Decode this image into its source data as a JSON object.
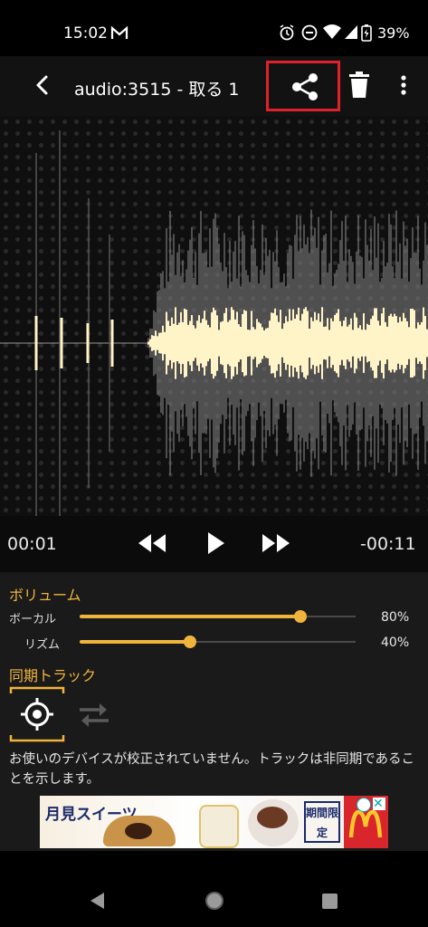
{
  "status": {
    "time": "15:02",
    "battery": "39%"
  },
  "appbar": {
    "title": "audio:3515 - 取る 1"
  },
  "transport": {
    "elapsed": "00:01",
    "remaining": "-00:11"
  },
  "volume": {
    "title": "ボリューム",
    "vocal": {
      "label": "ボーカル",
      "value": "80%",
      "level": 0.8
    },
    "rhythm": {
      "label": "リズム",
      "value": "40%",
      "level": 0.4
    }
  },
  "sync": {
    "title": "同期トラック",
    "message": "お使いのデバイスが校正されていません。トラックは非同期であることを示します。"
  },
  "ad": {
    "headline": "月見スイーツ",
    "badge": "期間限定"
  },
  "colors": {
    "accent": "#f0b43c",
    "waveform": "#fff3c8",
    "highlight": "#e0202a"
  }
}
